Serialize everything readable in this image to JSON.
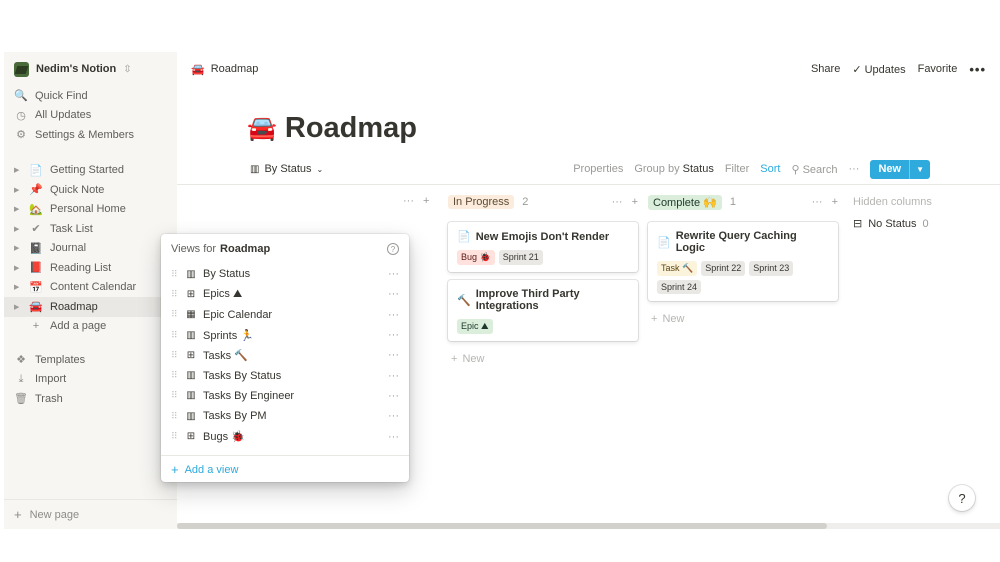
{
  "sidebar": {
    "workspace": "Nedim's Notion",
    "workspace_chevron": "⇳",
    "top_items": [
      {
        "icon": "search-icon",
        "glyph": "🔍",
        "label": "Quick Find"
      },
      {
        "icon": "clock-icon",
        "glyph": "◷",
        "label": "All Updates"
      },
      {
        "icon": "gear-icon",
        "glyph": "⚙",
        "label": "Settings & Members"
      }
    ],
    "pages": [
      {
        "glyph": "📄",
        "label": "Getting Started",
        "active": false
      },
      {
        "glyph": "📌",
        "label": "Quick Note",
        "active": false
      },
      {
        "glyph": "🏡",
        "label": "Personal Home",
        "active": false
      },
      {
        "glyph": "✔",
        "label": "Task List",
        "active": false
      },
      {
        "glyph": "📓",
        "label": "Journal",
        "active": false
      },
      {
        "glyph": "📕",
        "label": "Reading List",
        "active": false
      },
      {
        "glyph": "📅",
        "label": "Content Calendar",
        "active": false
      },
      {
        "glyph": "🚘",
        "label": "Roadmap",
        "active": true
      }
    ],
    "add_page": "Add a page",
    "bottom_items": [
      {
        "icon": "templates-icon",
        "glyph": "❖",
        "label": "Templates"
      },
      {
        "icon": "import-icon",
        "glyph": "⤓",
        "label": "Import"
      },
      {
        "icon": "trash-icon",
        "glyph": "🗑",
        "label": "Trash"
      }
    ],
    "new_page": "New page"
  },
  "topbar": {
    "breadcrumb_icon": "🚘",
    "breadcrumb": "Roadmap",
    "share": "Share",
    "updates": "Updates",
    "favorite": "Favorite",
    "more": "•••"
  },
  "page": {
    "emoji": "🚘",
    "title": "Roadmap"
  },
  "viewbar": {
    "current_view": "By Status",
    "properties": "Properties",
    "group_by_prefix": "Group by",
    "group_by_value": "Status",
    "filter": "Filter",
    "sort": "Sort",
    "search": "Search",
    "more": "···",
    "new_label": "New"
  },
  "board": {
    "columns": [
      {
        "label": "In Progress",
        "count": "2",
        "tag_bg": "#fbecdd",
        "tag_color": "#5f4b32",
        "cards": [
          {
            "title": "New Emojis Don't Render",
            "icon": "📄",
            "tags": [
              {
                "text": "Bug 🐞",
                "bg": "#ffe2dd",
                "color": "#5d1715"
              },
              {
                "text": "Sprint 21",
                "bg": "#e9e8e5",
                "color": "#37352f"
              }
            ]
          },
          {
            "title": "Improve Third Party Integrations",
            "icon": "🔨",
            "tags": [
              {
                "text": "Epic ⛰",
                "bg": "#dbeddb",
                "color": "#1c3829"
              }
            ]
          }
        ],
        "add_label": "New"
      },
      {
        "label": "Complete 🙌",
        "count": "1",
        "tag_bg": "#dbeddb",
        "tag_color": "#1c3829",
        "cards": [
          {
            "title": "Rewrite Query Caching Logic",
            "icon": "📄",
            "tags": [
              {
                "text": "Task 🔨",
                "bg": "#fbf3db",
                "color": "#5c4413"
              },
              {
                "text": "Sprint 22",
                "bg": "#e9e8e5",
                "color": "#37352f"
              },
              {
                "text": "Sprint 23",
                "bg": "#e9e8e5",
                "color": "#37352f"
              },
              {
                "text": "Sprint 24",
                "bg": "#e9e8e5",
                "color": "#37352f"
              }
            ]
          }
        ],
        "add_label": "New"
      }
    ],
    "hidden_columns_label": "Hidden columns",
    "no_status_label": "No Status",
    "no_status_count": "0"
  },
  "views_popup": {
    "prefix": "Views for",
    "name": "Roadmap",
    "items": [
      {
        "icon": "board-icon",
        "glyph": "▥",
        "label": "By Status"
      },
      {
        "icon": "table-icon",
        "glyph": "⊞",
        "label": "Epics ⛰"
      },
      {
        "icon": "calendar-icon",
        "glyph": "▦",
        "label": "Epic Calendar"
      },
      {
        "icon": "board-icon",
        "glyph": "▥",
        "label": "Sprints 🏃"
      },
      {
        "icon": "table-icon",
        "glyph": "⊞",
        "label": "Tasks 🔨"
      },
      {
        "icon": "board-icon",
        "glyph": "▥",
        "label": "Tasks By Status"
      },
      {
        "icon": "board-icon",
        "glyph": "▥",
        "label": "Tasks By Engineer"
      },
      {
        "icon": "board-icon",
        "glyph": "▥",
        "label": "Tasks By PM"
      },
      {
        "icon": "table-icon",
        "glyph": "⊞",
        "label": "Bugs 🐞"
      }
    ],
    "add_view": "Add a view"
  },
  "help_label": "?",
  "colors": {
    "accent": "#2eaadc",
    "sidebar_bg": "#f7f6f3",
    "text": "#37352f"
  }
}
